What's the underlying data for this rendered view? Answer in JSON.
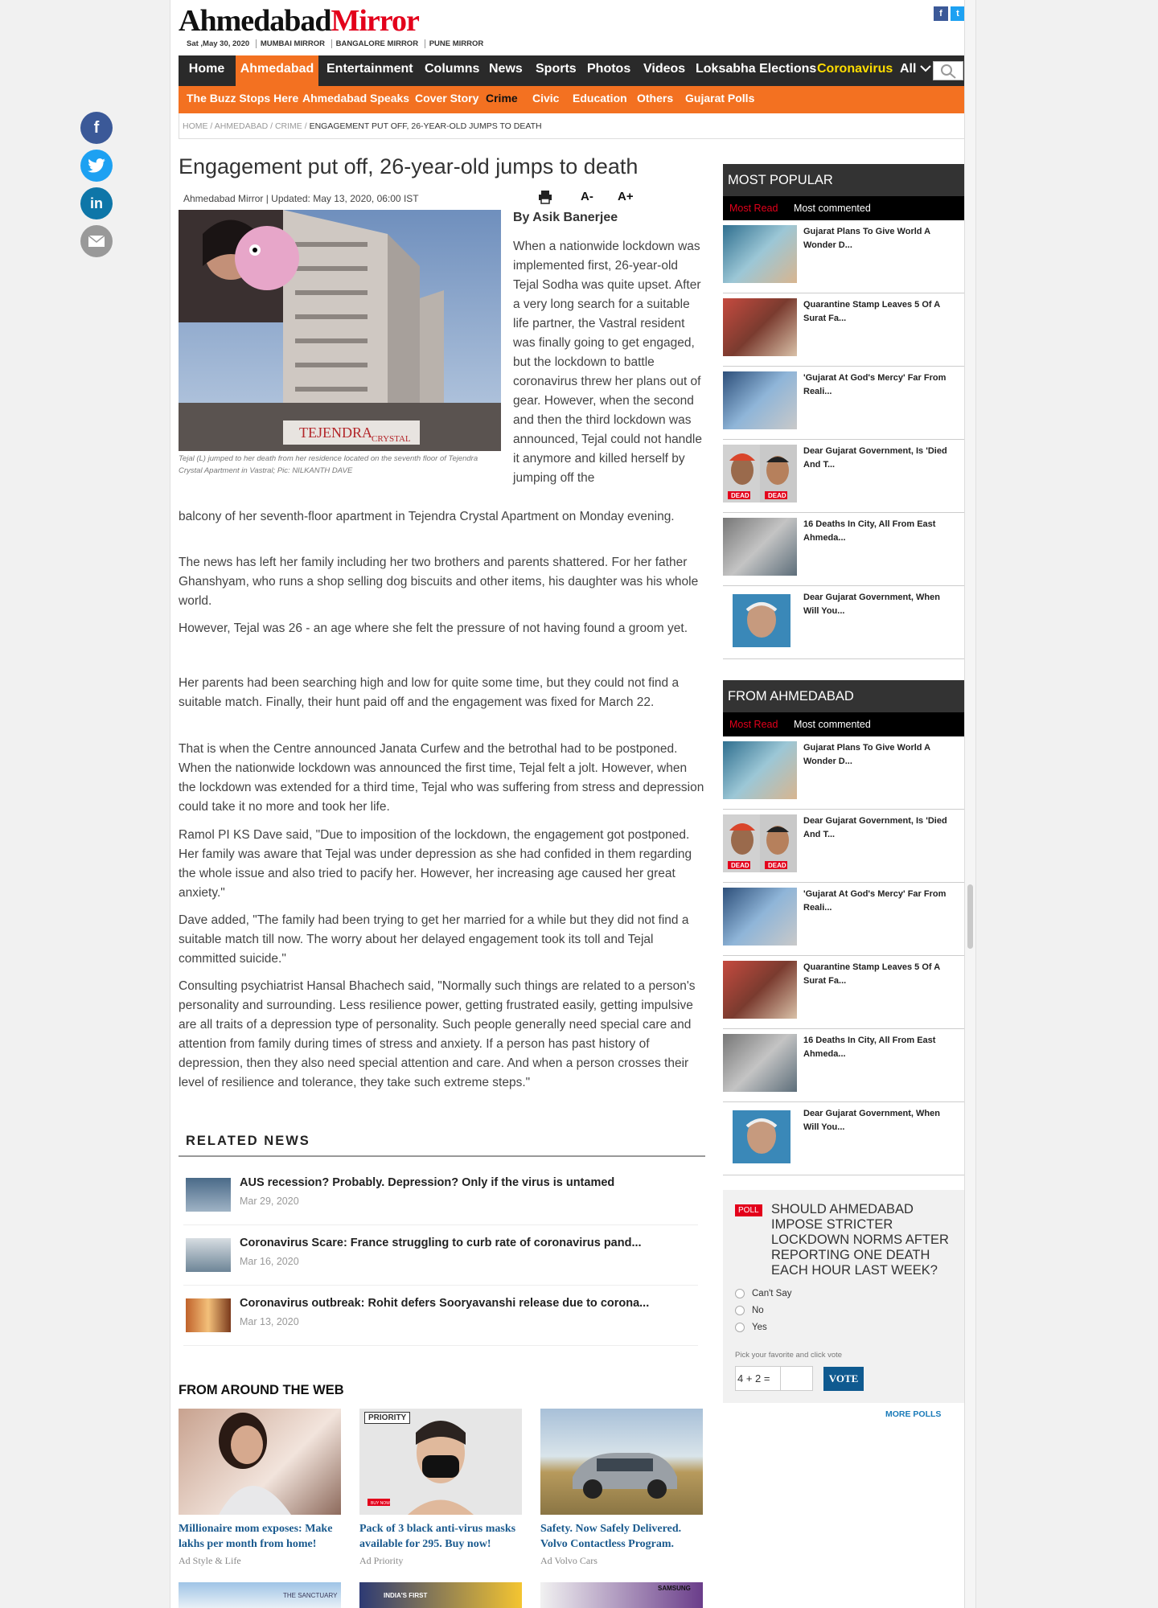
{
  "brand": {
    "left": "Ahmedabad",
    "right": "Mirror"
  },
  "header": {
    "date": "Sat ,May 30, 2020",
    "links": [
      "MUMBAI MIRROR",
      "BANGALORE MIRROR",
      "PUNE MIRROR"
    ]
  },
  "nav": {
    "main": [
      "Home",
      "Ahmedabad",
      "Entertainment",
      "Columns",
      "News",
      "Sports",
      "Photos",
      "Videos",
      "Loksabha Elections",
      "Coronavirus",
      "All"
    ],
    "sub": [
      "The Buzz Stops Here",
      "Ahmedabad Speaks",
      "Cover Story",
      "Crime",
      "Civic",
      "Education",
      "Others",
      "Gujarat Polls"
    ]
  },
  "breadcrumb": [
    "HOME",
    "AHMEDABAD",
    "CRIME",
    "ENGAGEMENT PUT OFF, 26-YEAR-OLD JUMPS TO DEATH"
  ],
  "article": {
    "headline": "Engagement put off, 26-year-old jumps to death",
    "meta": "Ahmedabad Mirror | Updated: May 13, 2020, 06:00 IST",
    "tools": {
      "decrease": "A-",
      "increase": "A+"
    },
    "byline": "By Asik Banerjee",
    "photo_text": {
      "line1": "TEJENDRA",
      "line2": "CRYSTAL"
    },
    "caption": "Tejal (L) jumped to her death from her residence located on the seventh floor of Tejendra Crystal Apartment in Vastral; Pic: NILKANTH DAVE",
    "lead_right": "When a nationwide lockdown was implemented first, 26-year-old Tejal Sodha was quite upset. After a very long search for a suitable life partner, the Vastral resident was finally going to get engaged, but the lockdown to battle coronavirus threw her plans out of gear. However, when the second and then the third lockdown was announced, Tejal could not handle it anymore and killed herself by jumping off the",
    "lead_full": "balcony of her seventh-floor apartment in Tejendra Crystal Apartment on Monday evening.",
    "paragraphs": [
      "The news has left her family including her two brothers and parents shattered. For her father Ghanshyam, who runs a shop selling dog biscuits and other items, his daughter was his whole world.",
      "However, Tejal was 26 - an age where she felt the pressure of not having found a groom yet.",
      "Her parents had been searching high and low for quite some time, but they could not find a suitable match. Finally, their hunt paid off and the engagement was fixed for March 22.",
      "That is when the Centre announced Janata Curfew and the betrothal had to be postponed. When the nationwide lockdown was announced the first time, Tejal felt a jolt. However, when the lockdown was extended for a third time, Tejal who was suffering from stress and depression could take it no more and took her life.",
      "Ramol PI KS Dave said, \"Due to imposition of the lockdown, the engagement got postponed. Her family was aware that Tejal was under depression as she had confided in them regarding the whole issue and also tried to pacify her. However, her increasing age caused her great anxiety.\"",
      "Dave added, \"The family had been trying to get her married for a while but they did not find a suitable match till now. The worry about her delayed engagement took its toll and Tejal committed suicide.\"",
      "Consulting psychiatrist Hansal Bhachech said, \"Normally such things are related to a person's personality and surrounding. Less resilience power, getting frustrated easily, getting impulsive are all traits of a depression type of personality. Such people generally need special care and attention from family during times of stress and anxiety. If a person has past history of depression, then they also need special attention and care. And when a person crosses their level of resilience and tolerance, they take such extreme steps.\""
    ]
  },
  "related": {
    "title": "RELATED NEWS",
    "items": [
      {
        "headline": "AUS recession? Probably. Depression? Only if the virus is untamed",
        "date": "Mar 29, 2020"
      },
      {
        "headline": "Coronavirus Scare: France struggling to curb rate of coronavirus pand...",
        "date": "Mar 16, 2020"
      },
      {
        "headline": "Coronavirus outbreak: Rohit defers Sooryavanshi release due to corona...",
        "date": "Mar 13, 2020"
      }
    ]
  },
  "from_web": {
    "title": "FROM AROUND THE WEB",
    "ads": [
      {
        "title": "Millionaire mom exposes: Make lakhs per month from home!",
        "source": "Ad  Style & Life"
      },
      {
        "title": "Pack of 3 black anti-virus masks available for 295. Buy now!",
        "source": "Ad  Priority",
        "badge": "PRIORITY",
        "tag": "BUY NOW"
      },
      {
        "title": "Safety. Now Safely Delivered. Volvo Contactless Program.",
        "source": "Ad  Volvo Cars"
      }
    ],
    "bottom_ads": [
      {
        "caption": "THE SANCTUARY"
      },
      {
        "caption": "INDIA'S FIRST"
      },
      {
        "caption": "SAMSUNG"
      }
    ]
  },
  "sidebar": {
    "popular": {
      "title": "MOST POPULAR",
      "tabs": [
        "Most Read",
        "Most commented"
      ],
      "items": [
        "Gujarat Plans To Give World A Wonder D...",
        "Quarantine Stamp Leaves 5 Of A Surat Fa...",
        "'Gujarat At God's Mercy' Far From Reali...",
        "Dear Gujarat Government, Is 'Died And T...",
        "16 Deaths In City, All From East Ahmeda...",
        "Dear Gujarat Government, When Will You..."
      ]
    },
    "from_ahmedabad": {
      "title": "FROM AHMEDABAD",
      "tabs": [
        "Most Read",
        "Most commented"
      ],
      "items": [
        "Gujarat Plans To Give World A Wonder D...",
        "Dear Gujarat Government, Is 'Died And T...",
        "'Gujarat At God's Mercy' Far From Reali...",
        "Quarantine Stamp Leaves 5 Of A Surat Fa...",
        "16 Deaths In City, All From East Ahmeda...",
        "Dear Gujarat Government, When Will You..."
      ]
    },
    "dead_label": "DEAD"
  },
  "poll": {
    "badge": "POLL",
    "question": "SHOULD AHMEDABAD IMPOSE STRICTER LOCKDOWN NORMS AFTER REPORTING ONE DEATH EACH HOUR LAST WEEK?",
    "options": [
      "Can't Say",
      "No",
      "Yes"
    ],
    "hint": "Pick your favorite and click vote",
    "captcha": "4 + 2 =",
    "vote_label": "VOTE",
    "more_label": "MORE POLLS"
  },
  "share_icons": [
    "facebook-icon",
    "twitter-icon",
    "linkedin-icon",
    "email-icon"
  ],
  "colors": {
    "accent": "#f37121",
    "brand_red": "#e3001b",
    "nav_dark": "#2a2a2a",
    "coronavirus": "#ffdd00",
    "link_blue": "#1a5a8e"
  }
}
